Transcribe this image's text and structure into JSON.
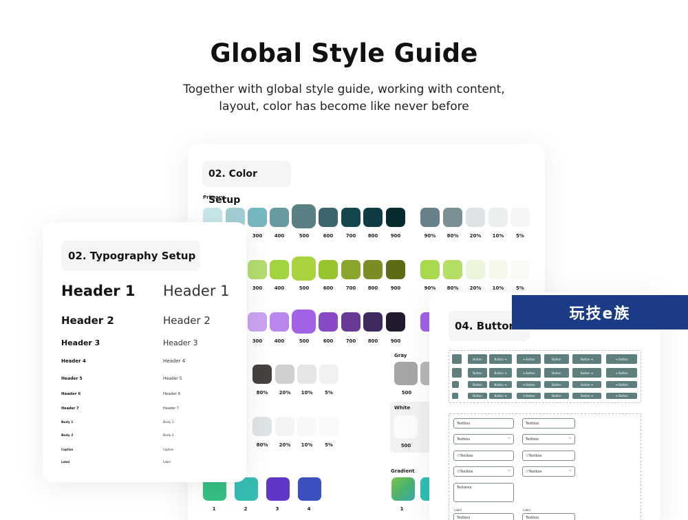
{
  "header": {
    "title": "Global Style Guide",
    "subtitle_line1": "Together with global style guide, working with content,",
    "subtitle_line2": "layout, color has become like never before"
  },
  "color_setup": {
    "title": "02. Color Setup",
    "primary_label": "Primary",
    "gray_label": "Gray",
    "white_label": "White",
    "gradient_label": "Gradient",
    "shade_labels": [
      "300",
      "400",
      "500",
      "600",
      "700",
      "800",
      "900"
    ],
    "alpha_labels": [
      "90%",
      "80%",
      "20%",
      "10%",
      "5%"
    ],
    "alpha_labels_short": [
      "80%",
      "20%",
      "10%",
      "5%"
    ],
    "gray_shade": "500",
    "white_shade": "500",
    "gradient_numbers": [
      "1",
      "2",
      "3",
      "4"
    ],
    "gradient_number_right": "1",
    "colors": {
      "teal": [
        "#c8e7ea",
        "#a2ced4",
        "#77b7c0",
        "#6a9aa1",
        "#5a7f84",
        "#3c666b",
        "#13474b",
        "#0d3d43",
        "#062b2e"
      ],
      "teal_alpha": [
        "#68808a",
        "#7b8f95",
        "#dde3e4",
        "#eceff0",
        "#f5f7f7"
      ],
      "green": [
        "#cde8a1",
        "#b4dc71",
        "#a1d43e",
        "#a8d33c",
        "#98c42d",
        "#89a52c",
        "#7b8c26",
        "#5f6a14"
      ],
      "green_alpha": [
        "#a9d94d",
        "#b5de65",
        "#ecf6dc",
        "#f4f9ec",
        "#f9fcf5"
      ],
      "purple": [
        "#dcc5f8",
        "#c9a4f0",
        "#b787ec",
        "#a162e6",
        "#8a4ac5",
        "#683a96",
        "#3f2a60",
        "#231a30"
      ],
      "dark_alpha": [
        "#45413e",
        "#cfcfcf",
        "#e5e5e5",
        "#f1f1f1"
      ],
      "light_alpha": [
        "#dfe4e6",
        "#f3f4f5",
        "#f8f8f8",
        "#fafafa"
      ],
      "gray": [
        "#a6a6a6",
        "#b8b8b8"
      ],
      "gradients": [
        "#36c084",
        "#35bdb3",
        "#5f36c5",
        "#3b4fbf"
      ],
      "gradient_right": [
        "#7cc24b",
        "#2ec1b4"
      ]
    }
  },
  "typography": {
    "title": "02. Typography Setup",
    "bold": [
      "Header 1",
      "Header 2",
      "Header 3",
      "Header 4",
      "Header 5",
      "Header 6",
      "Header 7",
      "Body 1",
      "Body 2",
      "Caption",
      "Label"
    ],
    "regular": [
      "Header 1",
      "Header 2",
      "Header 3",
      "Header 4",
      "Header 5",
      "Header 6",
      "Header 7",
      "Body 1",
      "Body 2",
      "Caption",
      "Label"
    ]
  },
  "buttons": {
    "title": "04. Button",
    "button_label": "Button",
    "arrow": "➔",
    "textbox": "Textbox",
    "textarea": "Textarea",
    "label": "Label",
    "chevron": "⌵",
    "user_icon": "⚇"
  },
  "watermark": {
    "text": "玩技e族"
  }
}
